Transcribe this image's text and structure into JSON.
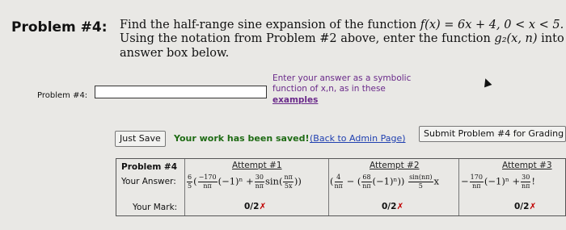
{
  "problem": {
    "heading": "Problem #4:",
    "line1_text": "Find the half-range sine expansion of the function",
    "line1_math": "f(x) = 6x + 4, 0 < x < 5.",
    "line2_text_a": "Using the notation from Problem #2 above, enter the function",
    "line2_math": "g₂(x, n)",
    "line2_text_b": "into the",
    "line3": "answer box below."
  },
  "answer": {
    "label": "Problem #4:",
    "value": "",
    "hint_line1": "Enter your answer as a symbolic",
    "hint_line2": "function of x,n, as in these",
    "hint_link": "examples"
  },
  "actions": {
    "just_save": "Just Save",
    "saved_message": "Your work has been saved!",
    "back_link": "(Back to Admin Page)",
    "submit": "Submit Problem #4 for Grading"
  },
  "results": {
    "header_label": "Problem #4",
    "answer_label": "Your Answer:",
    "mark_label": "Your Mark:",
    "attempts": [
      {
        "label": "Attempt #1",
        "mark": "0/2",
        "mark_icon": "x-mark"
      },
      {
        "label": "Attempt #2",
        "mark": "0/2",
        "mark_icon": "x-mark"
      },
      {
        "label": "Attempt #3",
        "mark": "0/2",
        "mark_icon": "x-mark"
      }
    ],
    "attempt1_answer": {
      "prefix_num": "6",
      "prefix_den": "5",
      "f1_num": "−170",
      "f1_den": "nπ",
      "mid": "(−1)ⁿ +",
      "f2_num": "30",
      "f2_den": "nπ",
      "sin": "sin(",
      "f3_num": "nπ",
      "f3_den": "5x",
      "tail": "))"
    },
    "attempt2_answer": {
      "open": "(",
      "f1_num": "4",
      "f1_den": "nπ",
      "minus": " − (",
      "f2_num": "68",
      "f2_den": "nπ",
      "mid": "(−1)ⁿ))",
      "f3_num": "sin(nπ)",
      "f3_den": "5",
      "tail": "x"
    },
    "attempt3_answer": {
      "lead": "−",
      "f1_num": "170",
      "f1_den": "nπ",
      "mid": "(−1)ⁿ +",
      "f2_num": "30",
      "f2_den": "nπ",
      "tail": "!"
    }
  }
}
